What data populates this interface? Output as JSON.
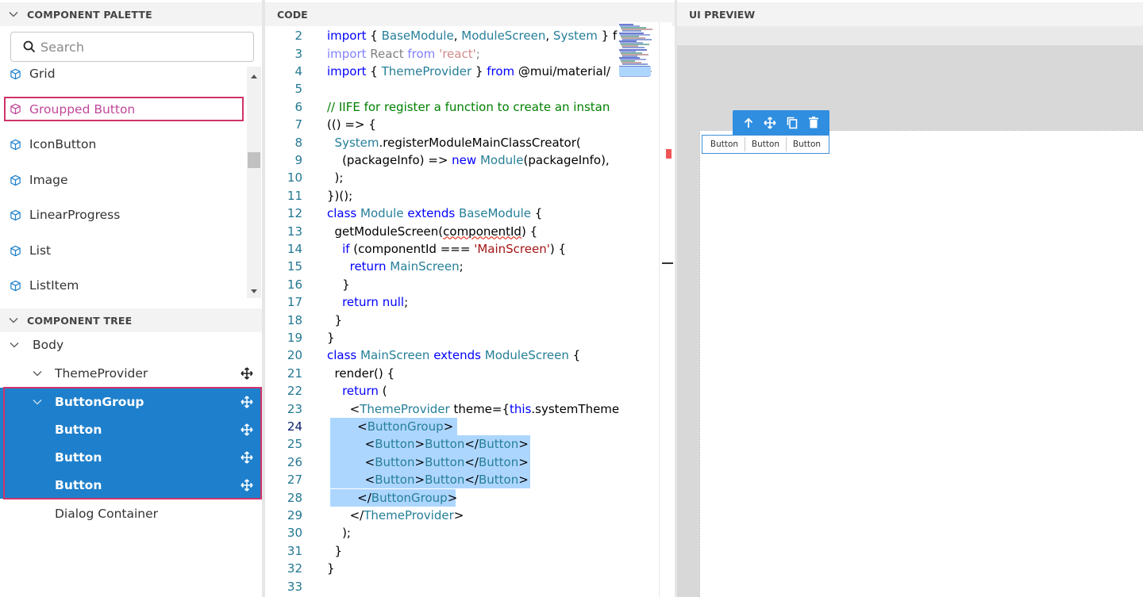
{
  "palette": {
    "header": "COMPONENT PALETTE",
    "search_placeholder": "Search",
    "items": [
      "Grid",
      "Groupped Button",
      "IconButton",
      "Image",
      "LinearProgress",
      "List",
      "ListItem"
    ],
    "selected_item": "Groupped Button"
  },
  "tree": {
    "header": "COMPONENT TREE",
    "nodes": [
      "Body",
      "ThemeProvider",
      "ButtonGroup",
      "Button",
      "Button",
      "Button",
      "Dialog Container"
    ]
  },
  "code": {
    "header": "CODE",
    "current_line": 24,
    "line_numbers": [
      2,
      3,
      4,
      5,
      6,
      7,
      8,
      9,
      10,
      11,
      12,
      13,
      14,
      15,
      16,
      17,
      18,
      19,
      20,
      21,
      22,
      23,
      24,
      25,
      26,
      27,
      28,
      29,
      30,
      31,
      32,
      33
    ],
    "lines": [
      {
        "n": "2",
        "t": "import { BaseModule, ModuleScreen, System } f"
      },
      {
        "n": "3",
        "t": "import React from 'react';"
      },
      {
        "n": "4",
        "t": "import { ThemeProvider } from '@mui/material/"
      },
      {
        "n": "5",
        "t": ""
      },
      {
        "n": "6",
        "t": "// IIFE for register a function to create an instan"
      },
      {
        "n": "7",
        "t": "(() => {"
      },
      {
        "n": "8",
        "t": "  System.registerModuleMainClassCreator("
      },
      {
        "n": "9",
        "t": "    (packageInfo) => new Module(packageInfo),"
      },
      {
        "n": "10",
        "t": "  );"
      },
      {
        "n": "11",
        "t": "})();"
      },
      {
        "n": "12",
        "t": "class Module extends BaseModule {"
      },
      {
        "n": "13",
        "t": "  getModuleScreen(componentId) {"
      },
      {
        "n": "14",
        "t": "    if (componentId === 'MainScreen') {"
      },
      {
        "n": "15",
        "t": "      return MainScreen;"
      },
      {
        "n": "16",
        "t": "    }"
      },
      {
        "n": "17",
        "t": "    return null;"
      },
      {
        "n": "18",
        "t": "  }"
      },
      {
        "n": "19",
        "t": "}"
      },
      {
        "n": "20",
        "t": "class MainScreen extends ModuleScreen {"
      },
      {
        "n": "21",
        "t": "  render() {"
      },
      {
        "n": "22",
        "t": "    return ("
      },
      {
        "n": "23",
        "t": "      <ThemeProvider theme={this.systemTheme}"
      },
      {
        "n": "24",
        "t": "        <ButtonGroup>"
      },
      {
        "n": "25",
        "t": "          <Button>Button</Button>"
      },
      {
        "n": "26",
        "t": "          <Button>Button</Button>"
      },
      {
        "n": "27",
        "t": "          <Button>Button</Button>"
      },
      {
        "n": "28",
        "t": "        </ButtonGroup>"
      },
      {
        "n": "29",
        "t": "      </ThemeProvider>"
      },
      {
        "n": "30",
        "t": "    );"
      },
      {
        "n": "31",
        "t": "  }"
      },
      {
        "n": "32",
        "t": "}"
      },
      {
        "n": "33",
        "t": ""
      }
    ]
  },
  "preview": {
    "header": "UI PREVIEW",
    "buttons": [
      "Button",
      "Button",
      "Button"
    ],
    "toolbar_icons": [
      "arrow-up-icon",
      "move-icon",
      "copy-icon",
      "delete-icon"
    ]
  },
  "colors": {
    "selection_blue": "#1e80cc",
    "highlight_pink": "#d0336b",
    "code_selection": "#add6ff",
    "keyword": "#0000ff",
    "type": "#267f99",
    "string": "#a31515"
  }
}
